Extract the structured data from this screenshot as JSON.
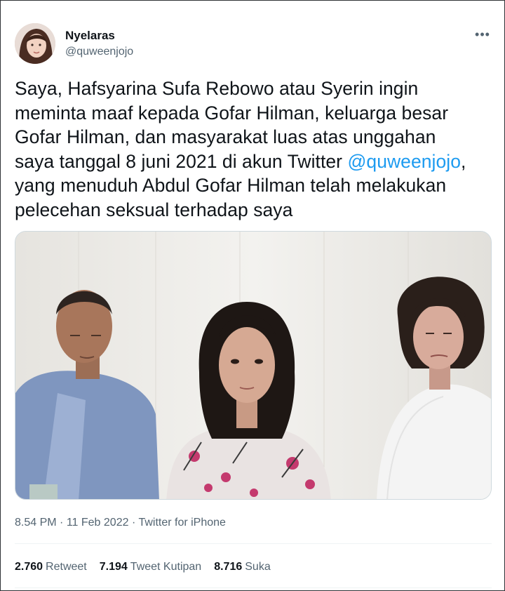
{
  "author": {
    "display_name": "Nyelaras",
    "handle": "@quweenjojo",
    "more_icon": "more-horizontal-icon"
  },
  "tweet": {
    "lines": [
      "Saya, Hafsyarina Sufa Rebowo atau Syerin ingin",
      "meminta maaf kepada Gofar Hilman, keluarga besar",
      "Gofar Hilman, dan masyarakat luas atas unggahan"
    ],
    "line4_before": "saya tanggal 8 juni 2021 di akun Twitter ",
    "line4_mention": "@quweenjojo",
    "line4_after": ",",
    "lines_end": [
      "yang menuduh Abdul Gofar Hilman telah melakukan",
      "pelecehan seksual terhadap saya"
    ]
  },
  "meta": {
    "time": "8.54 PM",
    "date": "11 Feb 2022",
    "source": "Twitter for iPhone"
  },
  "stats": {
    "retweets_count": "2.760",
    "retweets_label": "Retweet",
    "quotes_count": "7.194",
    "quotes_label": "Tweet Kutipan",
    "likes_count": "8.716",
    "likes_label": "Suka"
  },
  "colors": {
    "link": "#1d9bf0",
    "secondary_text": "#536471",
    "primary_text": "#0f1419"
  }
}
